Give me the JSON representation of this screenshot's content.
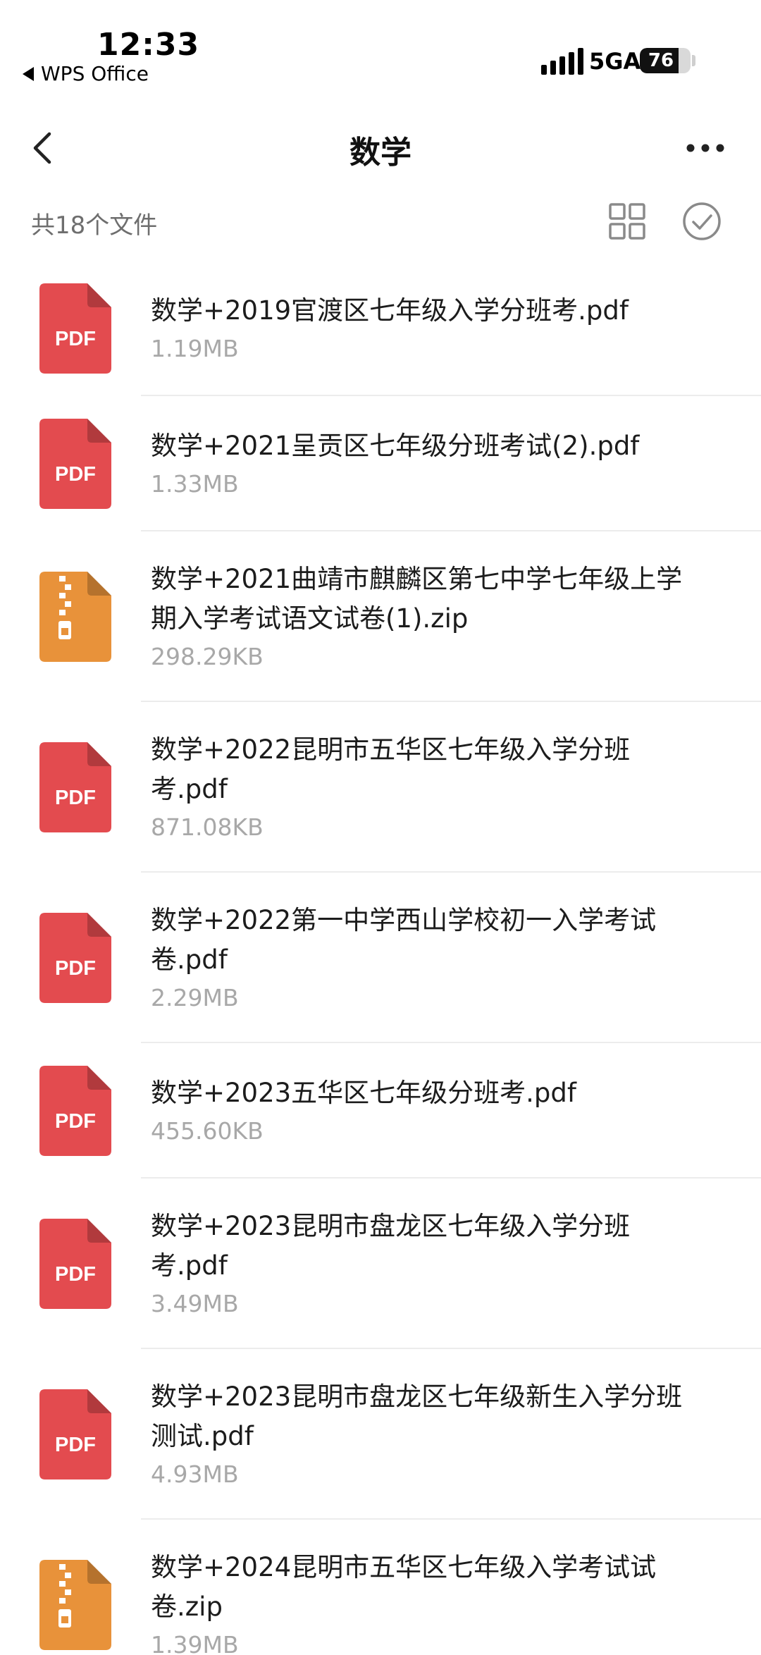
{
  "status_bar": {
    "time": "12:33",
    "back_app": "WPS Office",
    "network": "5GA",
    "battery_percent": 76
  },
  "header": {
    "title": "数学"
  },
  "toolbar": {
    "file_count": "共18个文件"
  },
  "colors": {
    "pdf_icon": "#e34b4f",
    "zip_icon": "#e8923a",
    "text_primary": "#1c1c1c",
    "text_secondary": "#a8a8a8"
  },
  "files": [
    {
      "name": "数学+2019官渡区七年级入学分班考.pdf",
      "size": "1.19MB",
      "type": "pdf",
      "icon_label": "PDF"
    },
    {
      "name": "数学+2021呈贡区七年级分班考试(2).pdf",
      "size": "1.33MB",
      "type": "pdf",
      "icon_label": "PDF"
    },
    {
      "name": "数学+2021曲靖市麒麟区第七中学七年级上学\n期入学考试语文试卷(1).zip",
      "size": "298.29KB",
      "type": "zip",
      "icon_label": ""
    },
    {
      "name": "数学+2022昆明市五华区七年级入学分班\n考.pdf",
      "size": "871.08KB",
      "type": "pdf",
      "icon_label": "PDF"
    },
    {
      "name": "数学+2022第一中学西山学校初一入学考试\n卷.pdf",
      "size": "2.29MB",
      "type": "pdf",
      "icon_label": "PDF"
    },
    {
      "name": "数学+2023五华区七年级分班考.pdf",
      "size": "455.60KB",
      "type": "pdf",
      "icon_label": "PDF"
    },
    {
      "name": "数学+2023昆明市盘龙区七年级入学分班\n考.pdf",
      "size": "3.49MB",
      "type": "pdf",
      "icon_label": "PDF"
    },
    {
      "name": "数学+2023昆明市盘龙区七年级新生入学分班\n测试.pdf",
      "size": "4.93MB",
      "type": "pdf",
      "icon_label": "PDF"
    },
    {
      "name": "数学+2024昆明市五华区七年级入学考试试\n卷.zip",
      "size": "1.39MB",
      "type": "zip",
      "icon_label": ""
    }
  ]
}
